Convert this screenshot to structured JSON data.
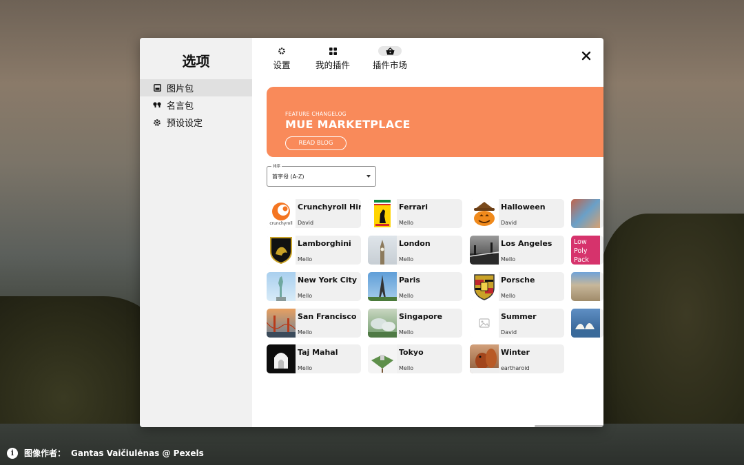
{
  "sidebar": {
    "title": "选项",
    "items": [
      {
        "label": "图片包",
        "icon": "image-icon",
        "active": true
      },
      {
        "label": "名言包",
        "icon": "quote-icon",
        "active": false
      },
      {
        "label": "预设设定",
        "icon": "gear-icon",
        "active": false
      }
    ]
  },
  "tabs": [
    {
      "label": "设置",
      "icon": "gear-icon",
      "active": false
    },
    {
      "label": "我的插件",
      "icon": "grid-icon",
      "active": false
    },
    {
      "label": "插件市场",
      "icon": "basket-icon",
      "active": true
    }
  ],
  "banner": {
    "kicker": "FEATURE CHANGELOG",
    "title": "MUE MARKETPLACE",
    "button": "READ BLOG",
    "color": "#f98a5a"
  },
  "sort": {
    "label": "排序",
    "value": "首字母 (A-Z)"
  },
  "items": [
    {
      "name": "Crunchyroll Hime",
      "author": "David"
    },
    {
      "name": "Ferrari",
      "author": "Mello"
    },
    {
      "name": "Halloween",
      "author": "David"
    },
    {
      "name": "Lamborghini",
      "author": "Mello"
    },
    {
      "name": "London",
      "author": "Mello"
    },
    {
      "name": "Los Angeles",
      "author": "Mello"
    },
    {
      "name": "New York City",
      "author": "Mello"
    },
    {
      "name": "Paris",
      "author": "Mello"
    },
    {
      "name": "Porsche",
      "author": "Mello"
    },
    {
      "name": "San Francisco",
      "author": "Mello"
    },
    {
      "name": "Singapore",
      "author": "Mello"
    },
    {
      "name": "Summer",
      "author": "David"
    },
    {
      "name": "Taj Mahal",
      "author": "Mello"
    },
    {
      "name": "Tokyo",
      "author": "Mello"
    },
    {
      "name": "Winter",
      "author": "eartharoid"
    }
  ],
  "thumb_text": {
    "crunchyroll": "crunchyroll",
    "lowpoly": "Low Poly Pack"
  },
  "credit": {
    "prefix": "图像作者：",
    "author": "Gantas Vaičiulėnas @ Pexels"
  }
}
